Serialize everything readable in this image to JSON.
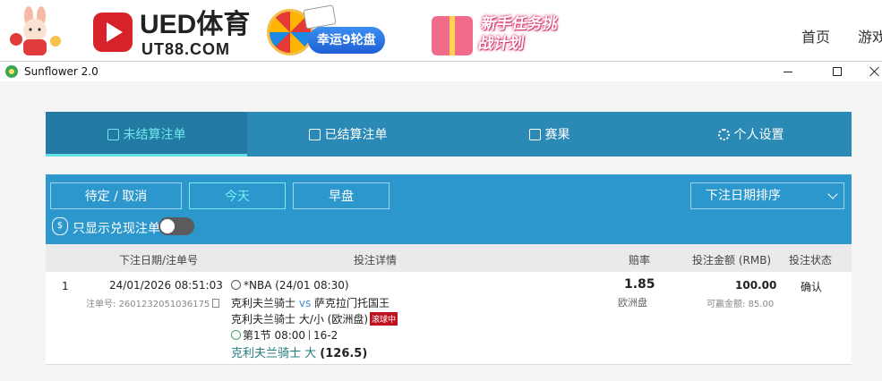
{
  "site_header": {
    "brand_name": "UED体育",
    "brand_url": "UT88.COM",
    "promo_wheel_label": "幸运9轮盘",
    "promo_task_label": "新手任务挑战计划",
    "nav": [
      "首页",
      "游戏"
    ]
  },
  "window": {
    "title": "Sunflower 2.0"
  },
  "main_tabs": [
    {
      "label": "未结算注单",
      "icon": "pending-bets-icon",
      "active": true
    },
    {
      "label": "已结算注单",
      "icon": "settled-bets-icon",
      "active": false
    },
    {
      "label": "赛果",
      "icon": "results-icon",
      "active": false
    },
    {
      "label": "个人设置",
      "icon": "gear-icon",
      "active": false
    }
  ],
  "filters": {
    "pending_cancel": "待定 / 取消",
    "today": "今天",
    "early": "早盘",
    "active": "今天",
    "sort": "下注日期排序",
    "cashout_only_label": "只显示兑现注单",
    "cashout_only_on": false
  },
  "table": {
    "headers": {
      "date_ref": "下注日期/注单号",
      "details": "投注详情",
      "odds": "赔率",
      "stake": "投注金额 (RMB)",
      "status": "投注状态"
    },
    "rows": [
      {
        "index": "1",
        "datetime": "24/01/2026 08:51:03",
        "ref_label": "注单号:",
        "ref_number": "2601232051036175",
        "league": "*NBA (24/01 08:30)",
        "home": "克利夫兰骑士",
        "vs": "vs",
        "away": "萨克拉门托国王",
        "market": "克利夫兰骑士 大/小 (欧洲盘)",
        "live_badge": "滚球中",
        "period": "第1节 08:00",
        "score": "16-2",
        "selection": "克利夫兰骑士 大",
        "line": "(126.5)",
        "odds": "1.85",
        "odds_type": "欧洲盘",
        "stake": "100.00",
        "winnable_label": "可赢金额:",
        "winnable": "85.00",
        "status": "确认"
      }
    ]
  },
  "colors": {
    "tab_bar": "#2a8ab5",
    "filter_bar": "#2b97cc",
    "active_accent": "#6fe8ec",
    "live_badge": "#c1121f",
    "brand_red": "#d8222a"
  }
}
